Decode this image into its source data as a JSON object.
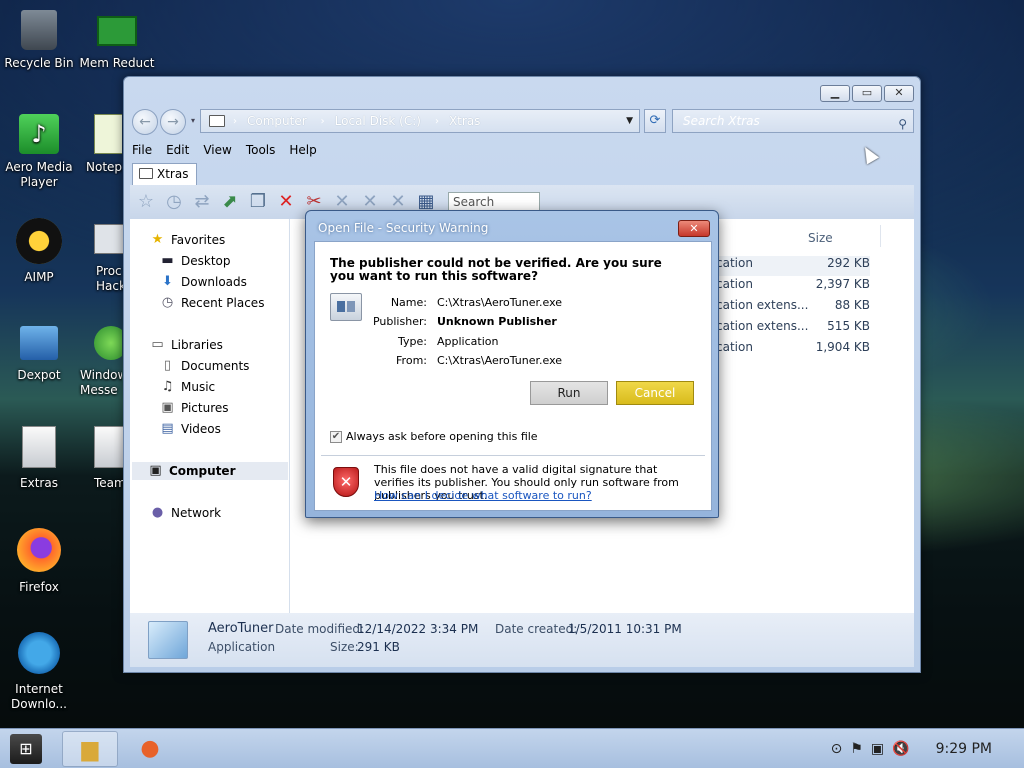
{
  "desktop": {
    "icons": [
      {
        "label": "Recycle Bin",
        "icon": "recycle-bin-icon"
      },
      {
        "label": "Mem Reduct",
        "icon": "memory-icon"
      },
      {
        "label": "Aero Media Player",
        "icon": "media-player-icon"
      },
      {
        "label": "Notepa",
        "icon": "notepad-icon"
      },
      {
        "label": "AIMP",
        "icon": "aimp-icon"
      },
      {
        "label": "Proc Hack",
        "icon": "process-hacker-icon"
      },
      {
        "label": "Dexpot",
        "icon": "dexpot-icon"
      },
      {
        "label": "Window Messe",
        "icon": "messenger-icon"
      },
      {
        "label": "Extras",
        "icon": "folder-icon"
      },
      {
        "label": "Team",
        "icon": "folder-icon"
      },
      {
        "label": "Firefox",
        "icon": "firefox-icon"
      },
      {
        "label": "Internet Downlo...",
        "icon": "download-manager-icon"
      }
    ]
  },
  "explorer": {
    "address": {
      "crumbs": [
        "Computer",
        "Local Disk (C:)",
        "Xtras"
      ]
    },
    "search_placeholder": "Search Xtras",
    "menu": [
      "File",
      "Edit",
      "View",
      "Tools",
      "Help"
    ],
    "tab_label": "Xtras",
    "toolbar_search": "Search",
    "nav": {
      "favorites": "Favorites",
      "desktop": "Desktop",
      "downloads": "Downloads",
      "recent": "Recent Places",
      "libraries": "Libraries",
      "documents": "Documents",
      "music": "Music",
      "pictures": "Pictures",
      "videos": "Videos",
      "computer": "Computer",
      "network": "Network"
    },
    "columns": {
      "size": "Size"
    },
    "files": [
      {
        "type": "cation",
        "size": "292 KB"
      },
      {
        "type": "cation",
        "size": "2,397 KB"
      },
      {
        "type": "cation extens...",
        "size": "88 KB"
      },
      {
        "type": "cation extens...",
        "size": "515 KB"
      },
      {
        "type": "cation",
        "size": "1,904 KB"
      }
    ],
    "details": {
      "name": "AeroTuner",
      "kind": "Application",
      "modified_label": "Date modified:",
      "modified": "12/14/2022 3:34 PM",
      "created_label": "Date created:",
      "created": "1/5/2011 10:31 PM",
      "size_label": "Size:",
      "size": "291 KB"
    }
  },
  "dialog": {
    "title": "Open File - Security Warning",
    "question": "The publisher could not be verified.  Are you sure you want to run this software?",
    "labels": {
      "name": "Name:",
      "publisher": "Publisher:",
      "type": "Type:",
      "from": "From:"
    },
    "values": {
      "name": "C:\\Xtras\\AeroTuner.exe",
      "publisher": "Unknown Publisher",
      "type": "Application",
      "from": "C:\\Xtras\\AeroTuner.exe"
    },
    "run_label": "Run",
    "cancel_label": "Cancel",
    "checkbox_label": "Always ask before opening this file",
    "checkbox_checked": true,
    "warning": "This file does not have a valid digital signature that verifies its publisher.  You should only run software from publishers you trust.",
    "link": "How can I decide what software to run?"
  },
  "taskbar": {
    "clock": "9:29 PM",
    "accent": "#d8bb1c"
  }
}
